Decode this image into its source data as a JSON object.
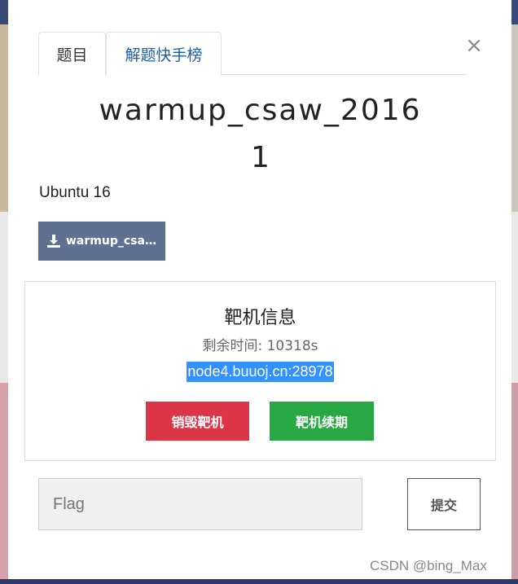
{
  "tabs": [
    {
      "label": "题目"
    },
    {
      "label": "解题快手榜"
    }
  ],
  "close_label": "×",
  "challenge": {
    "title_line1": "warmup_csaw_2016",
    "title_line2": "1",
    "description": "Ubuntu 16",
    "download_label": "warmup_csaw_2016"
  },
  "target_panel": {
    "title": "靶机信息",
    "remaining": "剩余时间: 10318s",
    "host": "node4.buuoj.cn:28978",
    "destroy_label": "销毁靶机",
    "renew_label": "靶机续期"
  },
  "flag": {
    "placeholder": "Flag",
    "submit_label": "提交"
  },
  "watermark": "CSDN @bing_Max",
  "colors": {
    "download_bg": "#5f7190",
    "destroy_bg": "#dc3545",
    "renew_bg": "#28a745",
    "selection": "#3390ff"
  }
}
